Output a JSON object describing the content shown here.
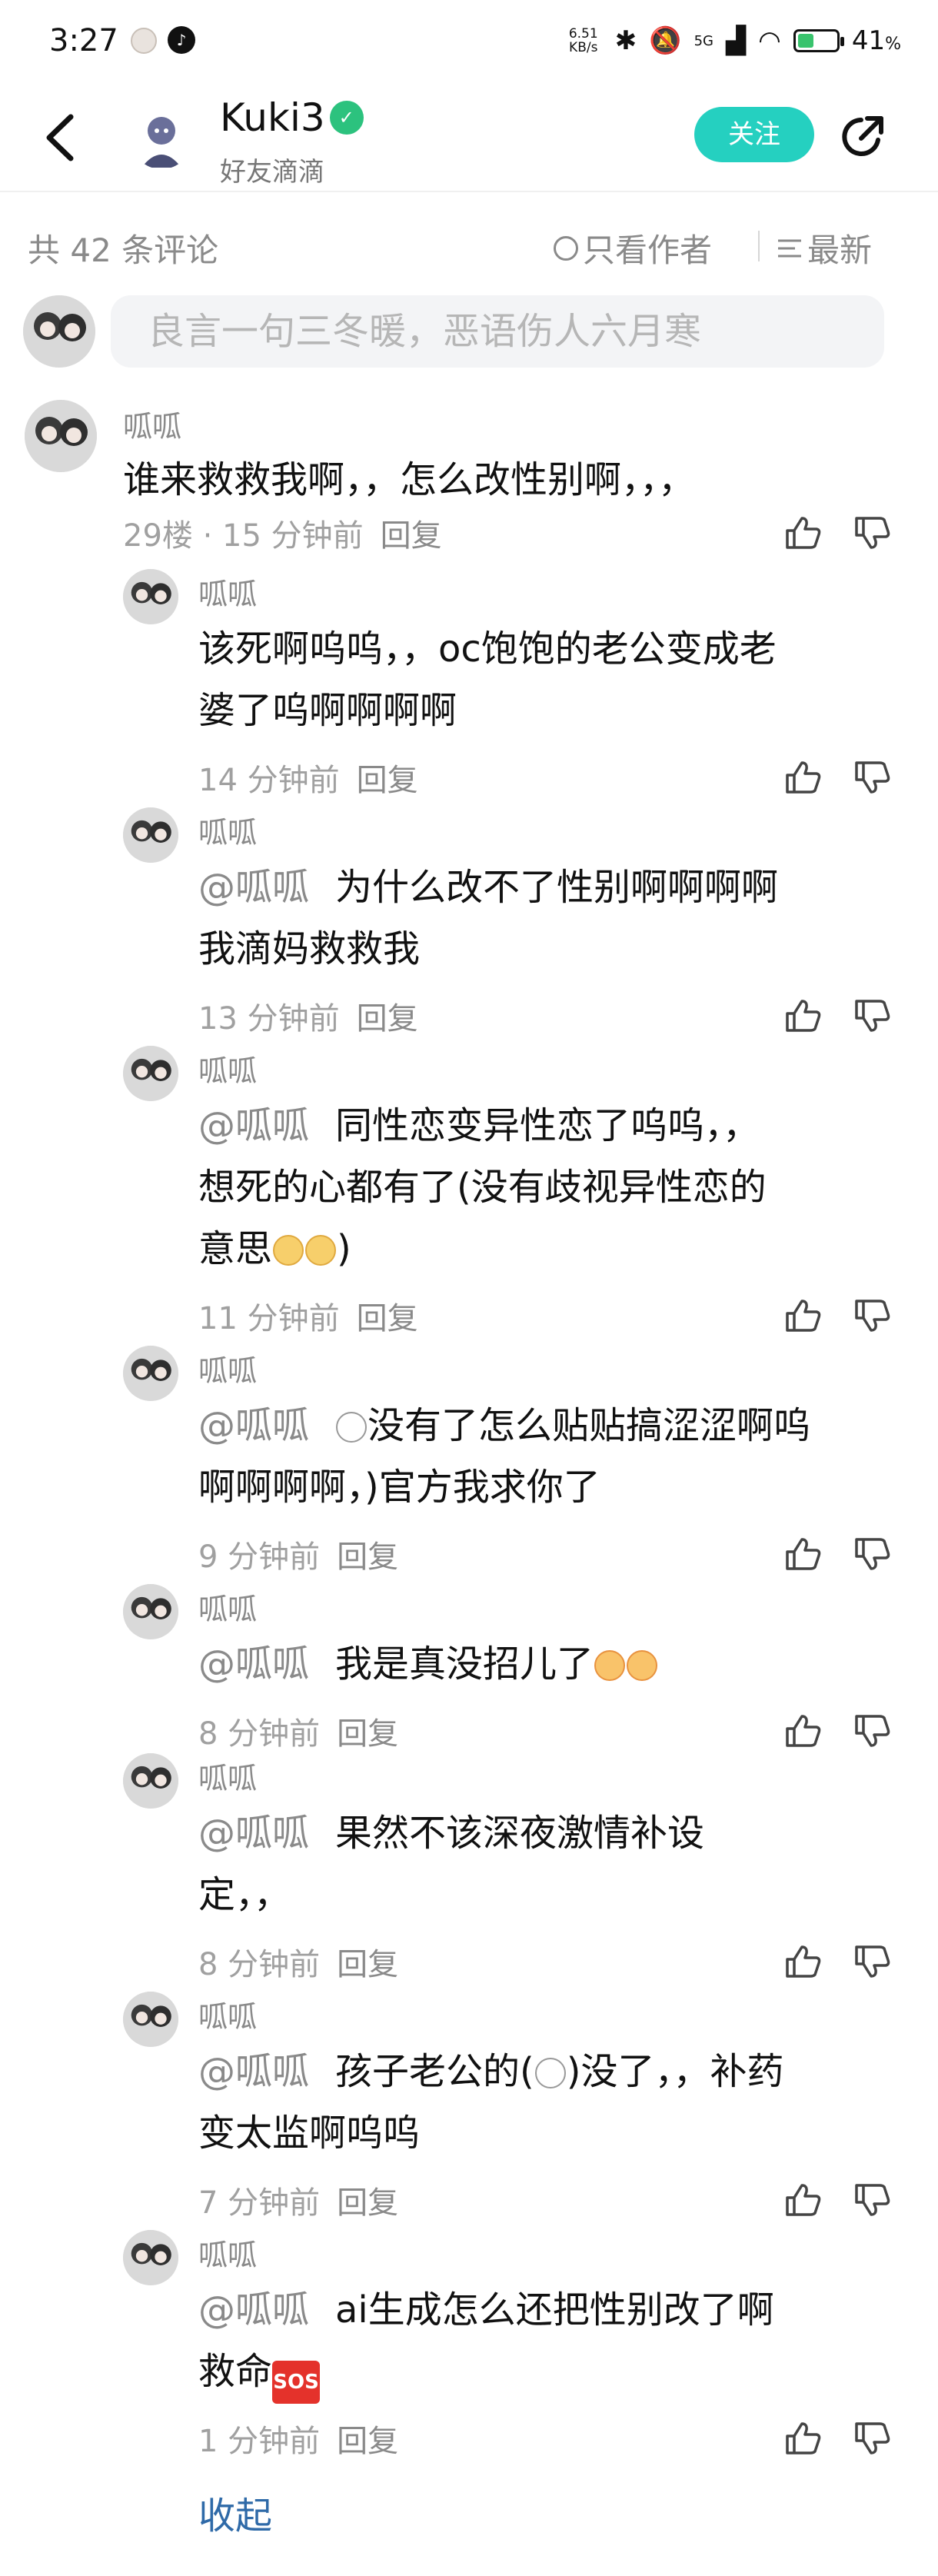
{
  "status_bar": {
    "time": "3:27",
    "net_speed_value": "6.51",
    "net_speed_unit": "KB/s",
    "net_type": "5G",
    "battery_percent": 41,
    "battery_label": "41",
    "battery_suffix": "%"
  },
  "header": {
    "username": "Kuki3",
    "subtitle": "好友滴滴",
    "follow_label": "关注"
  },
  "filter": {
    "count_label": "共 42 条评论",
    "author_only_label": "只看作者",
    "sort_label": "最新"
  },
  "input": {
    "placeholder": "良言一句三冬暖，恶语伤人六月寒"
  },
  "top_comment": {
    "name": "呱呱",
    "text": "谁来救救我啊，，怎么改性别啊，，，",
    "meta": "29楼 · 15 分钟前",
    "reply": "回复"
  },
  "replies": [
    {
      "name": "呱呱",
      "lines": [
        "该死啊呜呜，，oc饱饱的老公变成老",
        "婆了呜啊啊啊啊"
      ],
      "time": "14 分钟前",
      "reply": "回复"
    },
    {
      "name": "呱呱",
      "mention": "@呱呱",
      "lines": [
        "为什么改不了性别啊啊啊啊",
        "我滴妈救救我"
      ],
      "time": "13 分钟前",
      "reply": "回复"
    },
    {
      "name": "呱呱",
      "mention": "@呱呱",
      "lines": [
        "同性恋变异性恋了呜呜，，",
        "想死的心都有了(没有歧视异性恋的",
        "意思"
      ],
      "line3_tail": ")",
      "time": "11 分钟前",
      "reply": "回复"
    },
    {
      "name": "呱呱",
      "mention": "@呱呱",
      "lines": [
        "没有了怎么贴贴搞涩涩啊呜",
        "啊啊啊啊，)官方我求你了"
      ],
      "time": "9 分钟前",
      "reply": "回复"
    },
    {
      "name": "呱呱",
      "mention": "@呱呱",
      "lines": [
        "我是真没招儿了"
      ],
      "time": "8 分钟前",
      "reply": "回复"
    },
    {
      "name": "呱呱",
      "mention": "@呱呱",
      "lines": [
        "果然不该深夜激情补设",
        "定，，"
      ],
      "time": "8 分钟前",
      "reply": "回复"
    },
    {
      "name": "呱呱",
      "mention": "@呱呱",
      "lines_a": "孩子老公的(",
      "lines_b": ")没了，，补药",
      "line2": "变太监啊呜呜",
      "time": "7 分钟前",
      "reply": "回复"
    },
    {
      "name": "呱呱",
      "mention": "@呱呱",
      "lines": [
        "ai生成怎么还把性别改了啊",
        "救命"
      ],
      "sos": "SOS",
      "time": "1 分钟前",
      "reply": "回复"
    }
  ],
  "collapse_label": "收起",
  "icons": {
    "back": "back-arrow-icon",
    "share": "share-icon",
    "like": "thumbs-up-icon",
    "dislike": "thumbs-down-icon",
    "sort": "list-sort-icon"
  }
}
